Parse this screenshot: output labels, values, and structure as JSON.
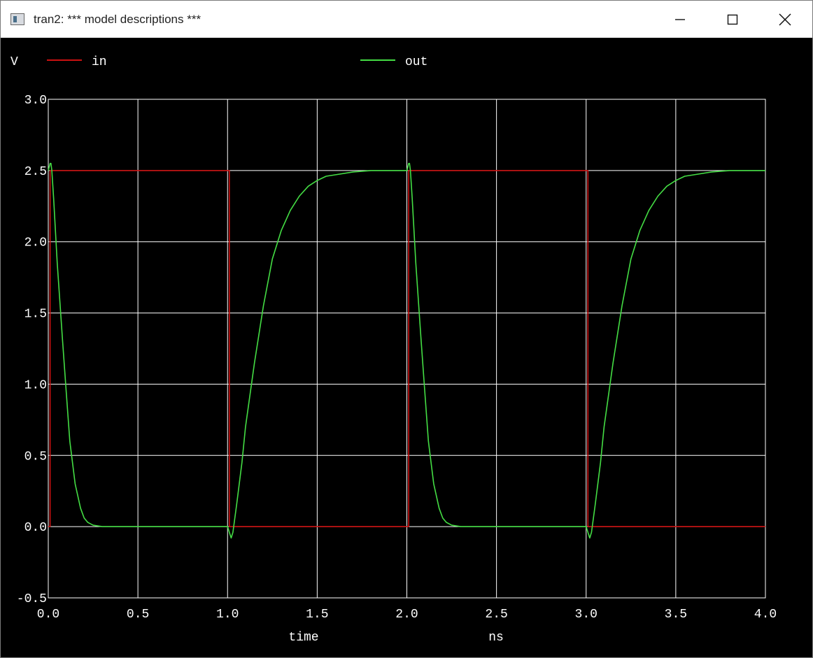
{
  "window": {
    "title": "tran2: *** model descriptions ***",
    "buttons": {
      "minimize": "minimize-icon",
      "maximize": "maximize-icon",
      "close": "close-icon"
    }
  },
  "chart_data": {
    "type": "line",
    "ylabel": "V",
    "xlabel": "time",
    "xunit": "ns",
    "xlim": [
      0.0,
      4.0
    ],
    "ylim": [
      -0.5,
      3.0
    ],
    "xticks": [
      "0.0",
      "0.5",
      "1.0",
      "1.5",
      "2.0",
      "2.5",
      "3.0",
      "3.5",
      "4.0"
    ],
    "yticks": [
      "3.0",
      "2.5",
      "2.0",
      "1.5",
      "1.0",
      "0.5",
      "0.0",
      "-0.5"
    ],
    "grid": true,
    "legend_placement": "top",
    "background": "#000000",
    "grid_color": "#ffffff",
    "series": [
      {
        "name": "in",
        "color": "#cc1111",
        "x": [
          0.0,
          0.01,
          0.01,
          1.0,
          1.01,
          1.01,
          2.0,
          2.01,
          2.01,
          3.0,
          3.01,
          3.01,
          4.0
        ],
        "y": [
          0.0,
          0.0,
          2.5,
          2.5,
          2.5,
          0.0,
          0.0,
          0.0,
          2.5,
          2.5,
          2.5,
          0.0,
          0.0
        ]
      },
      {
        "name": "out",
        "color": "#44dd44",
        "x": [
          0.0,
          0.01,
          0.015,
          0.02,
          0.03,
          0.05,
          0.08,
          0.1,
          0.12,
          0.15,
          0.18,
          0.2,
          0.22,
          0.25,
          0.3,
          0.5,
          1.0,
          1.01,
          1.02,
          1.03,
          1.05,
          1.08,
          1.1,
          1.15,
          1.2,
          1.25,
          1.3,
          1.35,
          1.4,
          1.45,
          1.5,
          1.55,
          1.6,
          1.7,
          1.8,
          1.9,
          2.0,
          2.01,
          2.015,
          2.02,
          2.03,
          2.05,
          2.08,
          2.1,
          2.12,
          2.15,
          2.18,
          2.2,
          2.22,
          2.25,
          2.3,
          2.5,
          3.0,
          3.01,
          3.02,
          3.03,
          3.05,
          3.08,
          3.1,
          3.15,
          3.2,
          3.25,
          3.3,
          3.35,
          3.4,
          3.45,
          3.5,
          3.55,
          3.6,
          3.7,
          3.8,
          3.9,
          4.0
        ],
        "y": [
          2.5,
          2.55,
          2.55,
          2.5,
          2.3,
          1.85,
          1.3,
          0.95,
          0.6,
          0.3,
          0.13,
          0.06,
          0.03,
          0.01,
          0.0,
          0.0,
          0.0,
          -0.04,
          -0.08,
          -0.04,
          0.15,
          0.45,
          0.7,
          1.15,
          1.55,
          1.88,
          2.08,
          2.22,
          2.32,
          2.39,
          2.43,
          2.46,
          2.47,
          2.49,
          2.5,
          2.5,
          2.5,
          2.55,
          2.55,
          2.5,
          2.3,
          1.85,
          1.3,
          0.95,
          0.6,
          0.3,
          0.13,
          0.06,
          0.03,
          0.01,
          0.0,
          0.0,
          0.0,
          -0.04,
          -0.08,
          -0.04,
          0.15,
          0.45,
          0.7,
          1.15,
          1.55,
          1.88,
          2.08,
          2.22,
          2.32,
          2.39,
          2.43,
          2.46,
          2.47,
          2.49,
          2.5,
          2.5,
          2.5
        ]
      }
    ]
  }
}
